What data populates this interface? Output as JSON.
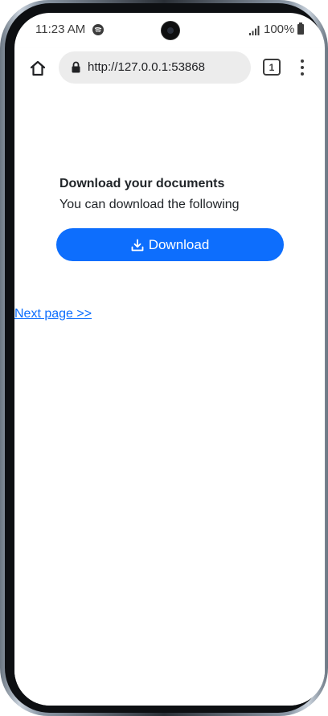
{
  "status_bar": {
    "time": "11:23 AM",
    "battery": "100%",
    "icons": [
      "spotify-icon",
      "camera-icon",
      "signal-icon",
      "battery-icon"
    ]
  },
  "browser": {
    "url": "http://127.0.0.1:53868",
    "tab_count": "1",
    "icons": [
      "home-icon",
      "lock-icon",
      "tabs-icon",
      "more-vert-icon"
    ]
  },
  "page": {
    "heading": "Download your documents",
    "subheading": "You can download the following",
    "download_label": "Download",
    "download_icon": "download-icon",
    "next_link": "Next page >>"
  },
  "colors": {
    "primary": "#0d6efd",
    "text": "#212529"
  }
}
